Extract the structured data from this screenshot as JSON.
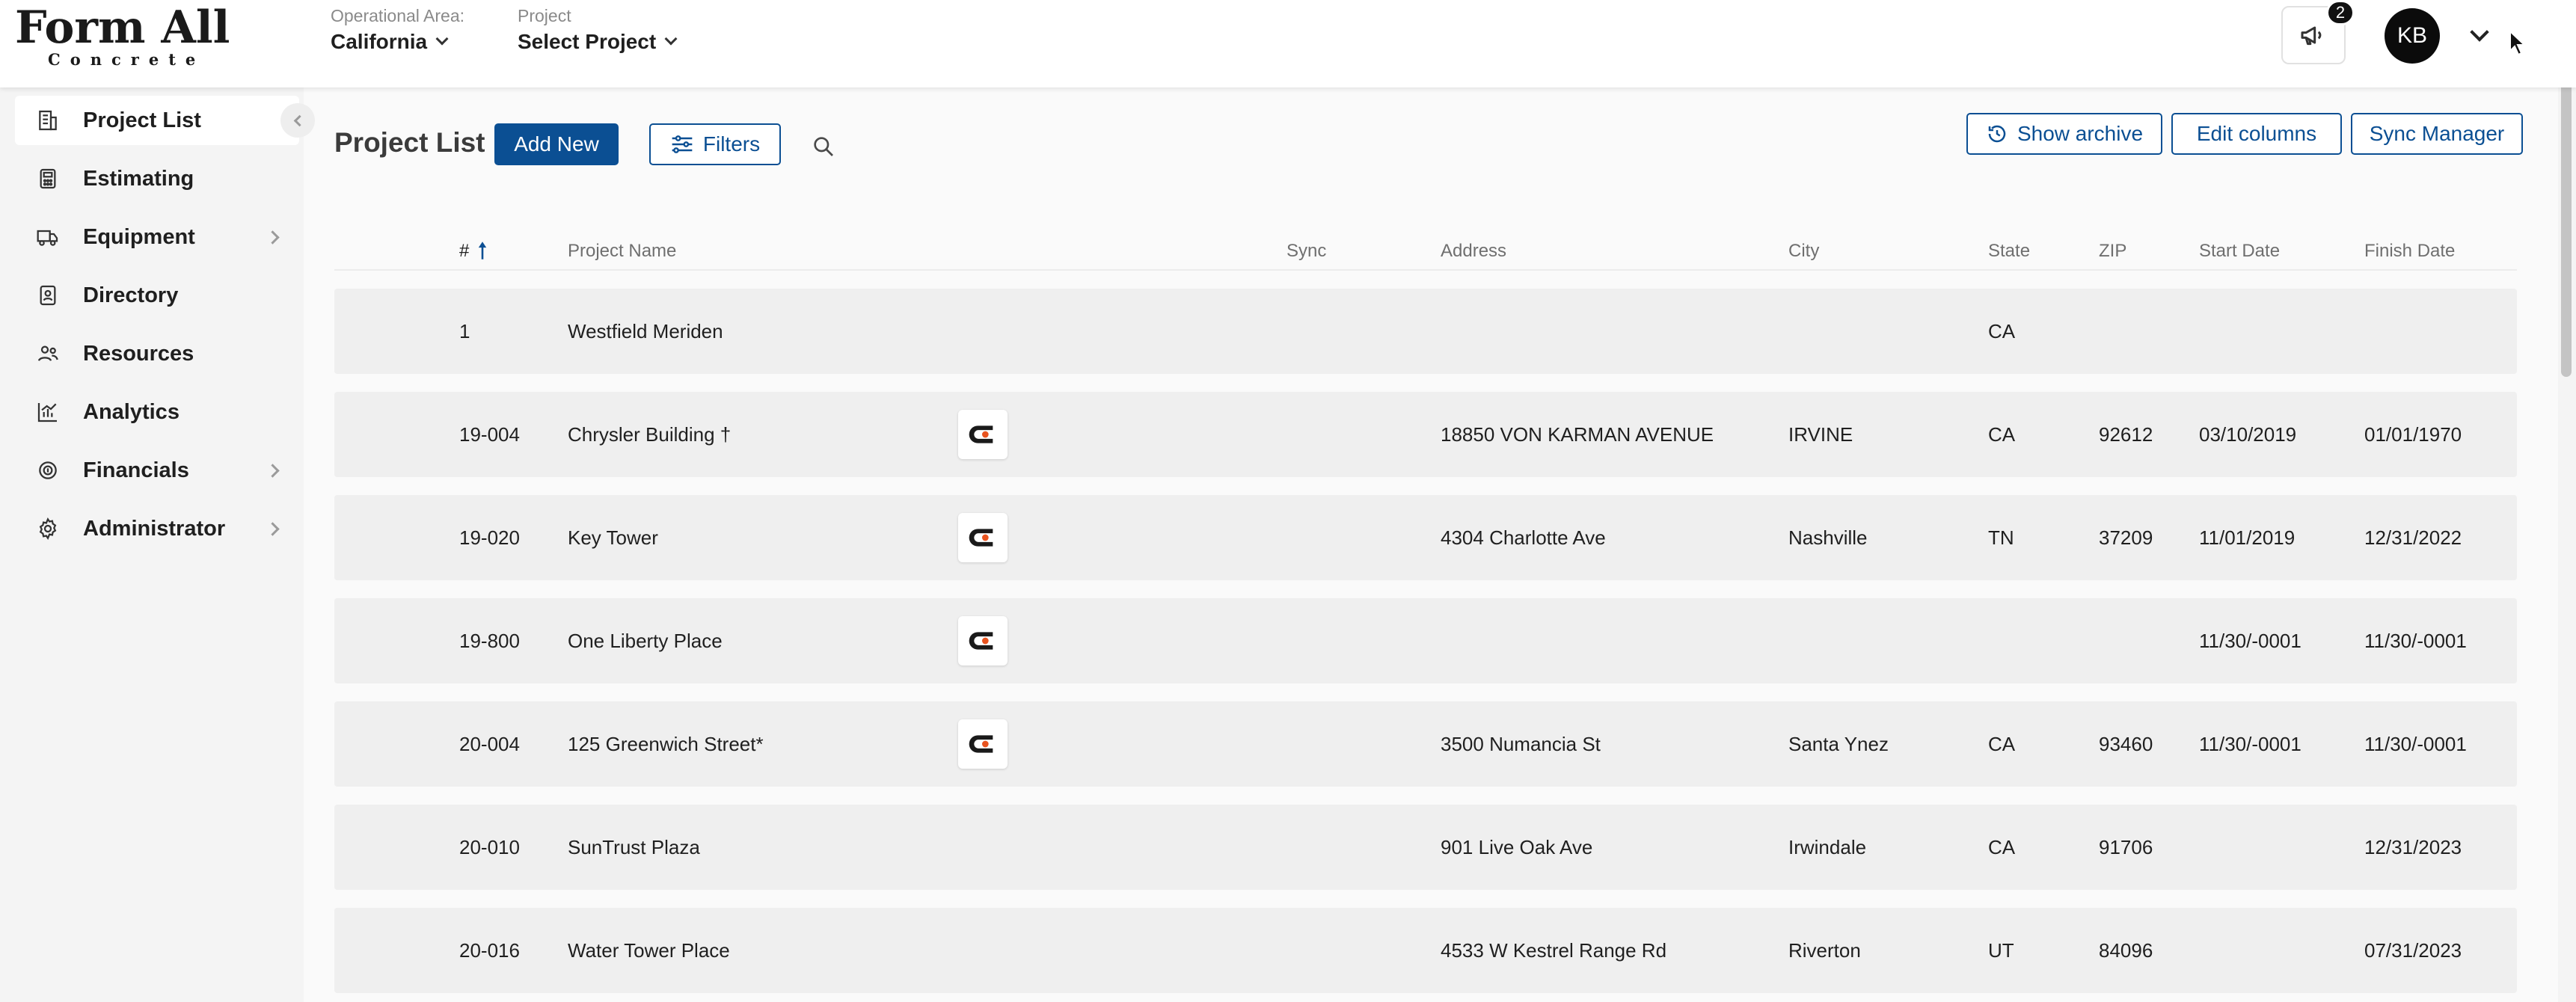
{
  "logo": {
    "main": "Form All",
    "sub": "Concrete"
  },
  "header": {
    "operational_area": {
      "label": "Operational Area:",
      "value": "California"
    },
    "project": {
      "label": "Project",
      "value": "Select Project"
    },
    "notifications_count": "2",
    "user_initials": "KB"
  },
  "sidebar": {
    "items": [
      {
        "label": "Project List",
        "icon": "building-icon",
        "active": true,
        "has_submenu": false
      },
      {
        "label": "Estimating",
        "icon": "calculator-icon",
        "active": false,
        "has_submenu": false
      },
      {
        "label": "Equipment",
        "icon": "truck-icon",
        "active": false,
        "has_submenu": true
      },
      {
        "label": "Directory",
        "icon": "contact-book-icon",
        "active": false,
        "has_submenu": false
      },
      {
        "label": "Resources",
        "icon": "people-icon",
        "active": false,
        "has_submenu": false
      },
      {
        "label": "Analytics",
        "icon": "chart-icon",
        "active": false,
        "has_submenu": false
      },
      {
        "label": "Financials",
        "icon": "coins-icon",
        "active": false,
        "has_submenu": true
      },
      {
        "label": "Administrator",
        "icon": "gear-icon",
        "active": false,
        "has_submenu": true
      }
    ]
  },
  "main": {
    "title": "Project List",
    "add_new_label": "Add New",
    "filters_label": "Filters",
    "show_archive_label": "Show archive",
    "edit_columns_label": "Edit columns",
    "sync_manager_label": "Sync Manager"
  },
  "table": {
    "columns": [
      "#",
      "Project Name",
      "Sync",
      "Address",
      "City",
      "State",
      "ZIP",
      "Start Date",
      "Finish Date"
    ],
    "sort_column": "#",
    "rows": [
      {
        "num": "1",
        "name": "Westfield Meriden",
        "sync": false,
        "address": "",
        "city": "",
        "state": "CA",
        "zip": "",
        "start": "",
        "finish": ""
      },
      {
        "num": "19-004",
        "name": "Chrysler Building †",
        "sync": true,
        "address": "18850 VON KARMAN AVENUE",
        "city": "IRVINE",
        "state": "CA",
        "zip": "92612",
        "start": "03/10/2019",
        "finish": "01/01/1970"
      },
      {
        "num": "19-020",
        "name": "Key Tower",
        "sync": true,
        "address": "4304 Charlotte Ave",
        "city": "Nashville",
        "state": "TN",
        "zip": "37209",
        "start": "11/01/2019",
        "finish": "12/31/2022"
      },
      {
        "num": "19-800",
        "name": "One Liberty Place",
        "sync": true,
        "address": "",
        "city": "",
        "state": "",
        "zip": "",
        "start": "11/30/-0001",
        "finish": "11/30/-0001"
      },
      {
        "num": "20-004",
        "name": "125 Greenwich Street*",
        "sync": true,
        "address": "3500 Numancia St",
        "city": "Santa Ynez",
        "state": "CA",
        "zip": "93460",
        "start": "11/30/-0001",
        "finish": "11/30/-0001"
      },
      {
        "num": "20-010",
        "name": "SunTrust Plaza",
        "sync": false,
        "address": "901 Live Oak Ave",
        "city": "Irwindale",
        "state": "CA",
        "zip": "91706",
        "start": "",
        "finish": "12/31/2023"
      },
      {
        "num": "20-016",
        "name": "Water Tower Place",
        "sync": false,
        "address": "4533 W Kestrel Range Rd",
        "city": "Riverton",
        "state": "UT",
        "zip": "84096",
        "start": "",
        "finish": "07/31/2023"
      }
    ]
  },
  "colors": {
    "primary": "#0b4f93",
    "sync_logo_accent": "#e8531f"
  }
}
